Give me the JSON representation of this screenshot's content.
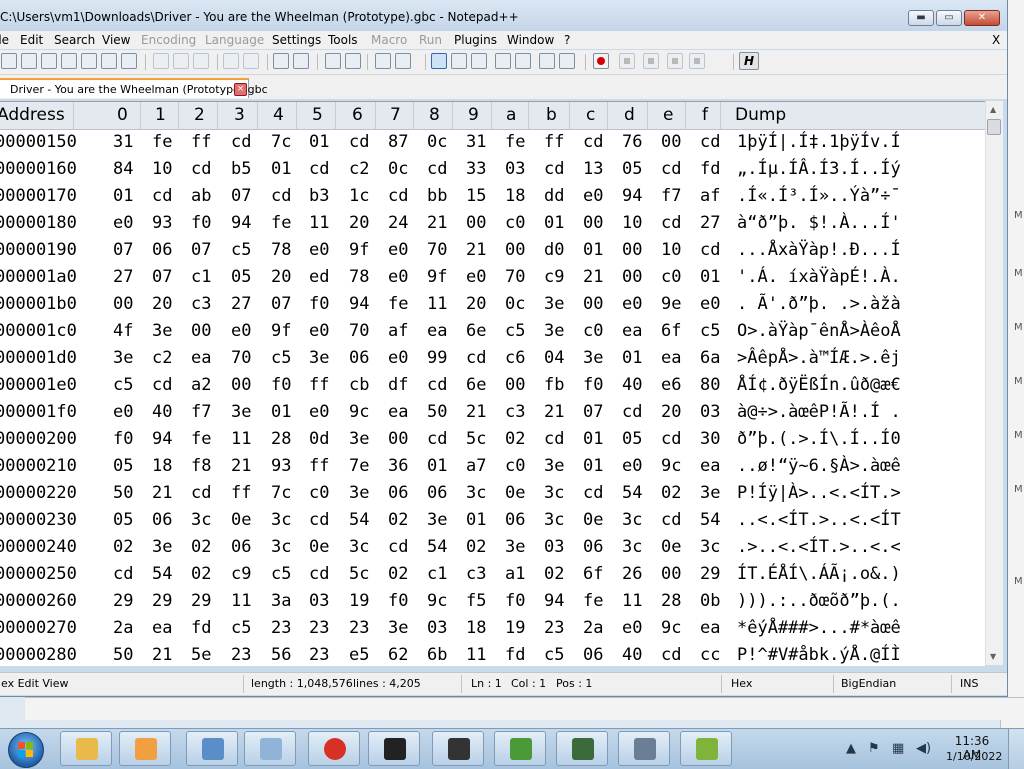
{
  "titlebar": {
    "title": "C:\\Users\\vm1\\Downloads\\Driver - You are the Wheelman (Prototype).gbc - Notepad++",
    "minimize": "▬",
    "maximize": "▭",
    "close": "✕"
  },
  "menu": {
    "items": [
      {
        "label": "ile",
        "disabled": false
      },
      {
        "label": "Edit",
        "disabled": false
      },
      {
        "label": "Search",
        "disabled": false
      },
      {
        "label": "View",
        "disabled": false
      },
      {
        "label": "Encoding",
        "disabled": true
      },
      {
        "label": "Language",
        "disabled": true
      },
      {
        "label": "Settings",
        "disabled": false
      },
      {
        "label": "Tools",
        "disabled": false
      },
      {
        "label": "Macro",
        "disabled": true
      },
      {
        "label": "Run",
        "disabled": true
      },
      {
        "label": "Plugins",
        "disabled": false
      },
      {
        "label": "Window",
        "disabled": false
      },
      {
        "label": "?",
        "disabled": false
      }
    ],
    "close_label": "X"
  },
  "toolbar": {
    "hex_button_label": "H",
    "icons": [
      "new-file-icon",
      "open-file-icon",
      "save-icon",
      "save-all-icon",
      "close-file-icon",
      "close-all-icon",
      "print-icon",
      "cut-icon",
      "copy-icon",
      "paste-icon",
      "undo-icon",
      "redo-icon",
      "find-icon",
      "replace-icon",
      "zoom-in-icon",
      "zoom-out-icon",
      "sync-vertical-icon",
      "sync-horizontal-icon",
      "word-wrap-icon",
      "show-all-chars-icon",
      "indent-guide-icon",
      "doc-map-icon",
      "function-list-icon",
      "folder-workspace-icon",
      "monitoring-icon",
      "record-macro-icon",
      "stop-record-icon",
      "play-macro-icon",
      "run-macro-multiple-icon",
      "save-macro-icon",
      "hex-editor-icon"
    ]
  },
  "tab": {
    "label": "Driver - You are the Wheelman (Prototype).gbc",
    "close": "×"
  },
  "hex_view": {
    "header": [
      "Address",
      "0",
      "1",
      "2",
      "3",
      "4",
      "5",
      "6",
      "7",
      "8",
      "9",
      "a",
      "b",
      "c",
      "d",
      "e",
      "f",
      "Dump"
    ],
    "rows": [
      {
        "addr": "00000150",
        "bytes": [
          "31",
          "fe",
          "ff",
          "cd",
          "7c",
          "01",
          "cd",
          "87",
          "0c",
          "31",
          "fe",
          "ff",
          "cd",
          "76",
          "00",
          "cd"
        ],
        "dump": "1þÿÍ|.Í‡.1þÿÍv.Í"
      },
      {
        "addr": "00000160",
        "bytes": [
          "84",
          "10",
          "cd",
          "b5",
          "01",
          "cd",
          "c2",
          "0c",
          "cd",
          "33",
          "03",
          "cd",
          "13",
          "05",
          "cd",
          "fd"
        ],
        "dump": "„.Íµ.ÍÂ.Í3.Í..Íý"
      },
      {
        "addr": "00000170",
        "bytes": [
          "01",
          "cd",
          "ab",
          "07",
          "cd",
          "b3",
          "1c",
          "cd",
          "bb",
          "15",
          "18",
          "dd",
          "e0",
          "94",
          "f7",
          "af"
        ],
        "dump": ".Í«.Í³.Í»..Ýà”÷¯"
      },
      {
        "addr": "00000180",
        "bytes": [
          "e0",
          "93",
          "f0",
          "94",
          "fe",
          "11",
          "20",
          "24",
          "21",
          "00",
          "c0",
          "01",
          "00",
          "10",
          "cd",
          "27"
        ],
        "dump": "à“ð”þ. $!.À...Í'"
      },
      {
        "addr": "00000190",
        "bytes": [
          "07",
          "06",
          "07",
          "c5",
          "78",
          "e0",
          "9f",
          "e0",
          "70",
          "21",
          "00",
          "d0",
          "01",
          "00",
          "10",
          "cd"
        ],
        "dump": "...ÅxàŸàp!.Ð...Í"
      },
      {
        "addr": "000001a0",
        "bytes": [
          "27",
          "07",
          "c1",
          "05",
          "20",
          "ed",
          "78",
          "e0",
          "9f",
          "e0",
          "70",
          "c9",
          "21",
          "00",
          "c0",
          "01"
        ],
        "dump": "'.Á. íxàŸàpÉ!.À."
      },
      {
        "addr": "000001b0",
        "bytes": [
          "00",
          "20",
          "c3",
          "27",
          "07",
          "f0",
          "94",
          "fe",
          "11",
          "20",
          "0c",
          "3e",
          "00",
          "e0",
          "9e",
          "e0"
        ],
        "dump": ". Ã'.ð”þ. .>.àžà"
      },
      {
        "addr": "000001c0",
        "bytes": [
          "4f",
          "3e",
          "00",
          "e0",
          "9f",
          "e0",
          "70",
          "af",
          "ea",
          "6e",
          "c5",
          "3e",
          "c0",
          "ea",
          "6f",
          "c5"
        ],
        "dump": "O>.àŸàp¯ênÅ>ÀêoÅ"
      },
      {
        "addr": "000001d0",
        "bytes": [
          "3e",
          "c2",
          "ea",
          "70",
          "c5",
          "3e",
          "06",
          "e0",
          "99",
          "cd",
          "c6",
          "04",
          "3e",
          "01",
          "ea",
          "6a"
        ],
        "dump": ">ÂêpÅ>.à™ÍÆ.>.êj"
      },
      {
        "addr": "000001e0",
        "bytes": [
          "c5",
          "cd",
          "a2",
          "00",
          "f0",
          "ff",
          "cb",
          "df",
          "cd",
          "6e",
          "00",
          "fb",
          "f0",
          "40",
          "e6",
          "80"
        ],
        "dump": "ÅÍ¢.ðÿËßÍn.ûð@æ€"
      },
      {
        "addr": "000001f0",
        "bytes": [
          "e0",
          "40",
          "f7",
          "3e",
          "01",
          "e0",
          "9c",
          "ea",
          "50",
          "21",
          "c3",
          "21",
          "07",
          "cd",
          "20",
          "03"
        ],
        "dump": "à@÷>.àœêP!Ã!.Í ."
      },
      {
        "addr": "00000200",
        "bytes": [
          "f0",
          "94",
          "fe",
          "11",
          "28",
          "0d",
          "3e",
          "00",
          "cd",
          "5c",
          "02",
          "cd",
          "01",
          "05",
          "cd",
          "30"
        ],
        "dump": "ð”þ.(.>.Í\\.Í..Í0"
      },
      {
        "addr": "00000210",
        "bytes": [
          "05",
          "18",
          "f8",
          "21",
          "93",
          "ff",
          "7e",
          "36",
          "01",
          "a7",
          "c0",
          "3e",
          "01",
          "e0",
          "9c",
          "ea"
        ],
        "dump": "..ø!“ÿ~6.§À>.àœê"
      },
      {
        "addr": "00000220",
        "bytes": [
          "50",
          "21",
          "cd",
          "ff",
          "7c",
          "c0",
          "3e",
          "06",
          "06",
          "3c",
          "0e",
          "3c",
          "cd",
          "54",
          "02",
          "3e"
        ],
        "dump": "P!Íÿ|À>..<.<ÍT.>"
      },
      {
        "addr": "00000230",
        "bytes": [
          "05",
          "06",
          "3c",
          "0e",
          "3c",
          "cd",
          "54",
          "02",
          "3e",
          "01",
          "06",
          "3c",
          "0e",
          "3c",
          "cd",
          "54"
        ],
        "dump": "..<.<ÍT.>..<.<ÍT"
      },
      {
        "addr": "00000240",
        "bytes": [
          "02",
          "3e",
          "02",
          "06",
          "3c",
          "0e",
          "3c",
          "cd",
          "54",
          "02",
          "3e",
          "03",
          "06",
          "3c",
          "0e",
          "3c"
        ],
        "dump": ".>..<.<ÍT.>..<.<"
      },
      {
        "addr": "00000250",
        "bytes": [
          "cd",
          "54",
          "02",
          "c9",
          "c5",
          "cd",
          "5c",
          "02",
          "c1",
          "c3",
          "a1",
          "02",
          "6f",
          "26",
          "00",
          "29"
        ],
        "dump": "ÍT.ÉÅÍ\\.ÁÃ¡.o&.)"
      },
      {
        "addr": "00000260",
        "bytes": [
          "29",
          "29",
          "29",
          "11",
          "3a",
          "03",
          "19",
          "f0",
          "9c",
          "f5",
          "f0",
          "94",
          "fe",
          "11",
          "28",
          "0b"
        ],
        "dump": "))).:..ðœõð”þ.(."
      },
      {
        "addr": "00000270",
        "bytes": [
          "2a",
          "ea",
          "fd",
          "c5",
          "23",
          "23",
          "23",
          "3e",
          "03",
          "18",
          "19",
          "23",
          "2a",
          "e0",
          "9c",
          "ea"
        ],
        "dump": "*êýÅ###>...#*àœê"
      },
      {
        "addr": "00000280",
        "bytes": [
          "50",
          "21",
          "5e",
          "23",
          "56",
          "23",
          "e5",
          "62",
          "6b",
          "11",
          "fd",
          "c5",
          "06",
          "40",
          "cd",
          "cc"
        ],
        "dump": "P!^#V#åbk.ýÅ.@ÍÌ"
      }
    ]
  },
  "status": {
    "mode": "ex Edit View",
    "length": "length : 1,048,576",
    "lines": "lines : 4,205",
    "ln": "Ln : 1",
    "col": "Col : 1",
    "pos": "Pos : 1",
    "view": "Hex",
    "endian": "BigEndian",
    "ins": "INS"
  },
  "taskbar": {
    "apps": [
      "explorer-icon",
      "media-player-icon",
      "control-panel-icon",
      "notepad-icon",
      "chrome-icon",
      "7zip-icon",
      "gamepad-icon",
      "tool-icon",
      "terminal-icon",
      "window-icon",
      "notepadpp-icon"
    ],
    "time": "11:36 AM",
    "date": "1/10/2022"
  },
  "colors": {
    "accent_tab": "#f4a13b",
    "record": "#d40000",
    "close_button": "#c44c33"
  }
}
